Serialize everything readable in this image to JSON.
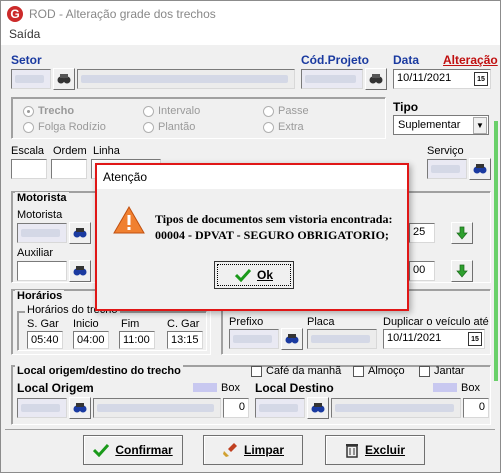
{
  "window": {
    "title": "ROD - Alteração grade dos trechos"
  },
  "menu": {
    "saida": "Saída"
  },
  "labels": {
    "setor": "Setor",
    "cod_projeto": "Cód.Projeto",
    "data": "Data",
    "alteracao": "Alteração",
    "tipo": "Tipo",
    "escala": "Escala",
    "ordem": "Ordem",
    "linha": "Linha",
    "servico": "Serviço",
    "motorista_section": "Motorista",
    "motorista": "Motorista",
    "auxiliar": "Auxiliar",
    "horarios_section": "Horários",
    "horarios_do_trecho": "Horários do trecho",
    "s_gar": "S. Gar",
    "inicio": "Inicio",
    "fim": "Fim",
    "c_gar": "C. Gar",
    "prefixo": "Prefixo",
    "placa": "Placa",
    "duplicar": "Duplicar o veículo até",
    "local_section": "Local origem/destino do trecho",
    "cafe": "Café da manhã",
    "almoco": "Almoço",
    "jantar": "Jantar",
    "local_origem": "Local Origem",
    "local_destino": "Local Destino",
    "box": "Box",
    "box2": "Box"
  },
  "fields": {
    "data_value": "10/11/2021",
    "tipo_value": "Suplementar",
    "s_gar": "05:40",
    "inicio": "04:00",
    "fim": "11:00",
    "c_gar": "13:15",
    "duplicar_value": "10/11/2021",
    "box_origem": "0",
    "box_destino": "0",
    "time_right_1": "25",
    "time_right_2": "00"
  },
  "radios": {
    "trecho": "Trecho",
    "intervalo": "Intervalo",
    "passe": "Passe",
    "folga": "Folga Rodízio",
    "plantao": "Plantão",
    "extra": "Extra"
  },
  "buttons": {
    "confirmar": "Confirmar",
    "limpar": "Limpar",
    "excluir": "Excluir"
  },
  "dialog": {
    "title": "Atenção",
    "line1": "Tipos de documentos sem vistoria encontrada:",
    "line2": "00004 - DPVAT - SEGURO OBRIGATORIO;",
    "ok": "Ok"
  },
  "colors": {
    "accent_red": "#cc2a2a",
    "label_blue": "#1a3aa0",
    "dialog_border": "#e01616",
    "warning_orange": "#f08030"
  }
}
